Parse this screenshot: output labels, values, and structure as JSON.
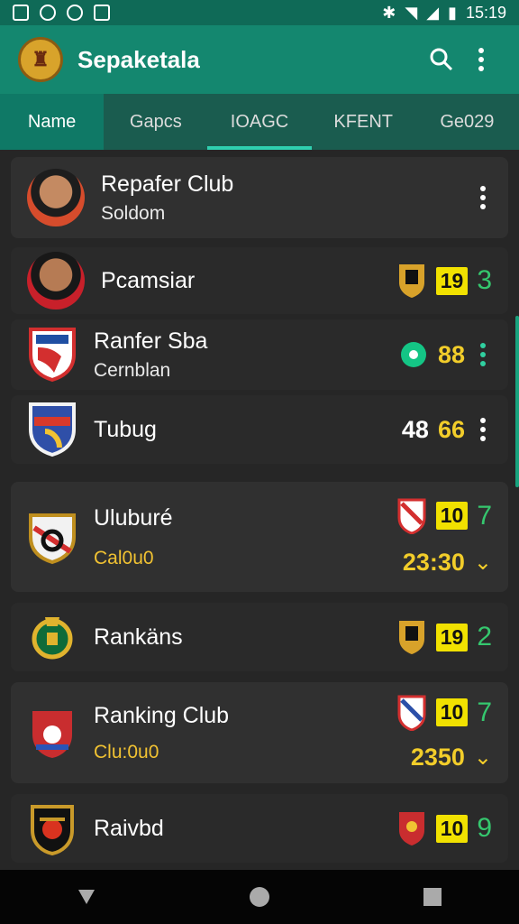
{
  "status": {
    "time": "15:19"
  },
  "app": {
    "title": "Sepaketala"
  },
  "icons": {
    "search": "search-icon",
    "more": "more-vert-icon"
  },
  "tabs": [
    "Name",
    "Gapcs",
    "IOAGC",
    "KFENT",
    "Ge029"
  ],
  "rows": [
    {
      "name": "Repafer Club",
      "sub": "Soldom",
      "right_type": "menu"
    },
    {
      "name": "Pcamsiar",
      "badge": "19",
      "score": "3"
    },
    {
      "name": "Ranfer Sba",
      "sub": "Cernblan",
      "score": "88"
    },
    {
      "name": "Tubug",
      "score_left": "48",
      "score": "66"
    },
    {
      "name": "Uluburé",
      "sub": "Cal0u0",
      "badge": "10",
      "score": "7",
      "time": "23:30"
    },
    {
      "name": "Rankäns",
      "badge": "19",
      "score": "2"
    },
    {
      "name": "Ranking Club",
      "sub": "Clu:0u0",
      "badge": "10",
      "score": "7",
      "time": "2350"
    },
    {
      "name": "Raivbd",
      "badge": "10",
      "score": "9"
    }
  ]
}
